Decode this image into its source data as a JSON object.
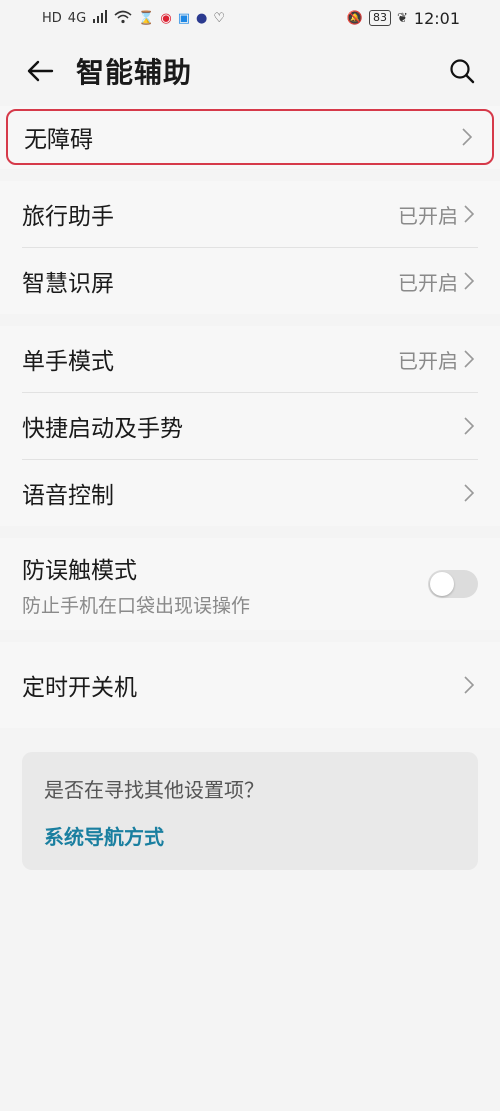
{
  "status_bar": {
    "left_icons": [
      "HD",
      "4G",
      "signal-icon",
      "wifi-icon",
      "hourglass-icon",
      "weibo-icon",
      "app-icon",
      "circle-icon",
      "heart-icon"
    ],
    "battery": "83",
    "time": "12:01"
  },
  "header": {
    "title": "智能辅助"
  },
  "groups": [
    {
      "items": [
        {
          "label": "无障碍",
          "value": ""
        }
      ]
    },
    {
      "items": [
        {
          "label": "旅行助手",
          "value": "已开启"
        },
        {
          "label": "智慧识屏",
          "value": "已开启"
        }
      ]
    },
    {
      "items": [
        {
          "label": "单手模式",
          "value": "已开启"
        },
        {
          "label": "快捷启动及手势",
          "value": ""
        },
        {
          "label": "语音控制",
          "value": ""
        }
      ]
    },
    {
      "items": [
        {
          "label": "防误触模式",
          "sub": "防止手机在口袋出现误操作",
          "toggle": false
        }
      ]
    },
    {
      "items": [
        {
          "label": "定时开关机",
          "value": ""
        }
      ]
    }
  ],
  "suggestion": {
    "question": "是否在寻找其他设置项？",
    "link": "系统导航方式"
  },
  "colors": {
    "highlight_border": "#d63a4a",
    "link": "#1a7fa0"
  }
}
